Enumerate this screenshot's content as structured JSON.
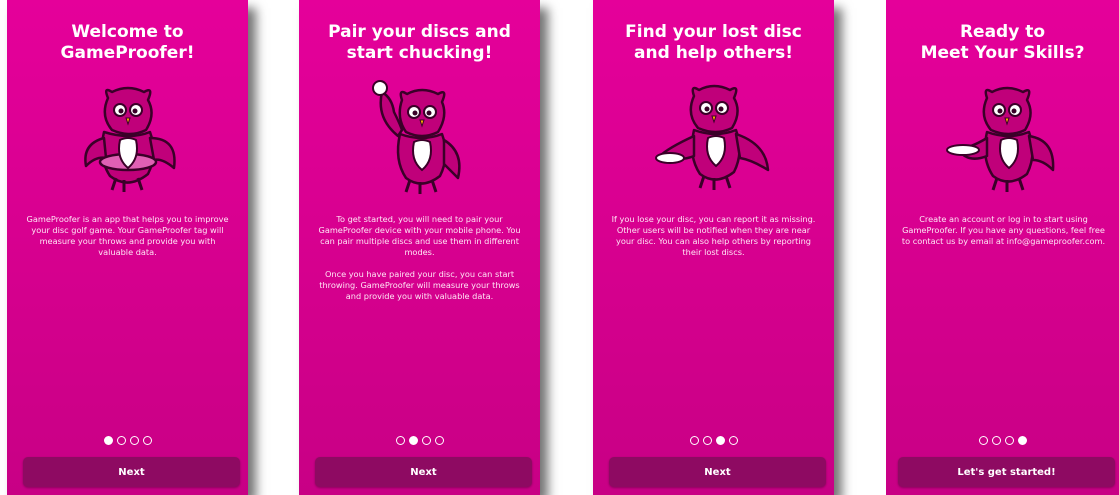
{
  "screens": [
    {
      "title": "Welcome to\nGameProofer!",
      "body": "GameProofer is an app that helps you to improve\nyour disc golf game. Your GameProofer tag will\nmeasure your throws and provide you with\nvaluable data.",
      "button": "Next",
      "active_dot": 0
    },
    {
      "title": "Pair your discs and\nstart chucking!",
      "body": "To get started, you will need to pair your\nGameProofer device with your mobile phone. You\ncan pair multiple discs and use them in different\nmodes.\n\nOnce you have paired your disc, you can start\nthrowing. GameProofer will measure your throws\nand provide you with valuable data.",
      "button": "Next",
      "active_dot": 1
    },
    {
      "title": "Find your lost disc\nand help others!",
      "body": "If you lose your disc, you can report it as missing.\nOther users will be notified when they are near\nyour disc. You can also help others by reporting\ntheir lost discs.",
      "button": "Next",
      "active_dot": 2
    },
    {
      "title": "Ready to\nMeet Your Skills?",
      "body": "Create an account or log in to start using\nGameProofer. If you have any questions, feel free\nto contact us by email at info@gameproofer.com.",
      "button": "Let's get started!",
      "active_dot": 3
    }
  ],
  "colors": {
    "background": "#e5009a",
    "button": "#8e0a62",
    "text": "#ffffff"
  },
  "icons": {
    "mascot": "owl-mascot-icon"
  }
}
